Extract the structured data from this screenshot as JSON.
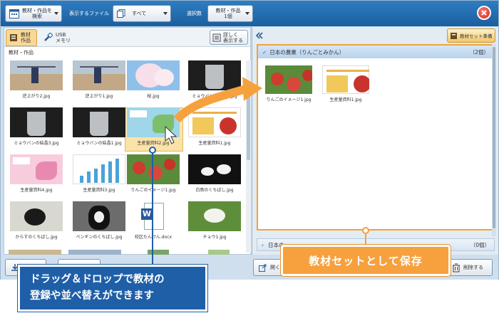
{
  "toolbar": {
    "material_btn_line1": "教材・作品を",
    "material_btn_line2": "検索",
    "show_file_label": "表示するファイル",
    "filter_value": "すべて",
    "select_count_label": "選択数",
    "select_count_line1": "教材・作品",
    "select_count_line2": "1個"
  },
  "left_panel": {
    "tab_material_line1": "教材",
    "tab_material_line2": "作品",
    "tab_usb_line1": "USB",
    "tab_usb_line2": "メモリ",
    "detail_line1": "詳しく",
    "detail_line2": "表示する",
    "section_label": "教材・作品",
    "files": [
      {
        "name": "逆上がり2.jpg",
        "kind": "photo-bar"
      },
      {
        "name": "逆上がり1.jpg",
        "kind": "photo-bar"
      },
      {
        "name": "桜.jpg",
        "kind": "photo-sakura"
      },
      {
        "name": "ミョウバンの結晶2.jpg",
        "kind": "photo-crystal"
      },
      {
        "name": "ミョウバンの結晶3.jpg",
        "kind": "photo-crystal"
      },
      {
        "name": "ミョウバンの結晶1.jpg",
        "kind": "photo-crystal"
      },
      {
        "name": "生産量資料2.jpg",
        "kind": "slide-map"
      },
      {
        "name": "生産量資料1.jpg",
        "kind": "slide-bars"
      },
      {
        "name": "生産量資料4.jpg",
        "kind": "slide-map-pink"
      },
      {
        "name": "生産量資料3.jpg",
        "kind": "slide-bars-blue"
      },
      {
        "name": "りんごのイメージ1.jpg",
        "kind": "photo-apple"
      },
      {
        "name": "白鳥のくちばし.jpg",
        "kind": "photo-swan"
      },
      {
        "name": "からすのくちばし.jpg",
        "kind": "photo-crow"
      },
      {
        "name": "ペンギンのくちばし.jpg",
        "kind": "photo-penguin"
      },
      {
        "name": "校区たんけん.docx",
        "kind": "doc-word"
      },
      {
        "name": "チョウ1.jpg",
        "kind": "photo-butterfly"
      }
    ]
  },
  "right_panel": {
    "prepare_label": "教材セット準備",
    "group1_title": "日本の農業（りんごとみかん）",
    "group1_count": "（2個）",
    "group1_items": [
      {
        "name": "りんごのイメージ1.jpg",
        "kind": "photo-apple"
      },
      {
        "name": "生産量資料1.jpg",
        "kind": "slide-bars"
      }
    ],
    "group2_title": "日本の",
    "group2_count": "（0個）"
  },
  "bottom": {
    "open_label": "開く",
    "delete_label": "削除する"
  },
  "callouts": {
    "save_text": "教材セットとして保存",
    "drag_line1": "ドラッグ＆ドロップで教材の",
    "drag_line2": "登録や並べ替えができます"
  },
  "colors": {
    "accent": "#1f5fa8",
    "highlight": "#f6a13d",
    "selected": "#fbe3a8"
  }
}
